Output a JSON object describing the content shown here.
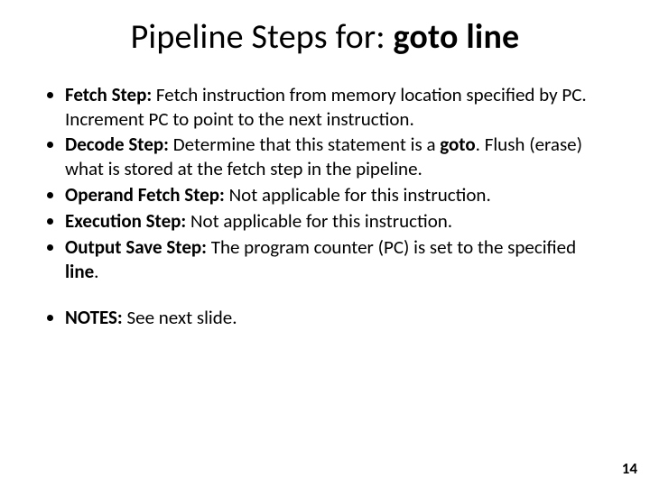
{
  "title_prefix": "Pipeline Steps for: ",
  "title_bold": "goto line",
  "bullets": [
    {
      "label": "Fetch Step:",
      "text": " Fetch instruction from memory location specified by PC. Increment PC to point to the next instruction."
    },
    {
      "label": "Decode Step:",
      "text_a": " Determine that this statement is a ",
      "inline_bold": "goto",
      "text_b": ". Flush (erase) what is stored at the fetch step in the pipeline."
    },
    {
      "label": "Operand Fetch Step:",
      "text": " Not applicable for this instruction."
    },
    {
      "label": "Execution Step:",
      "text": " Not applicable for this instruction."
    },
    {
      "label": "Output Save Step:",
      "text_a": " The program counter (PC) is set to the specified ",
      "inline_bold": "line",
      "text_b": "."
    }
  ],
  "notes": {
    "label": "NOTES:",
    "text": " See next slide."
  },
  "page_number": "14"
}
